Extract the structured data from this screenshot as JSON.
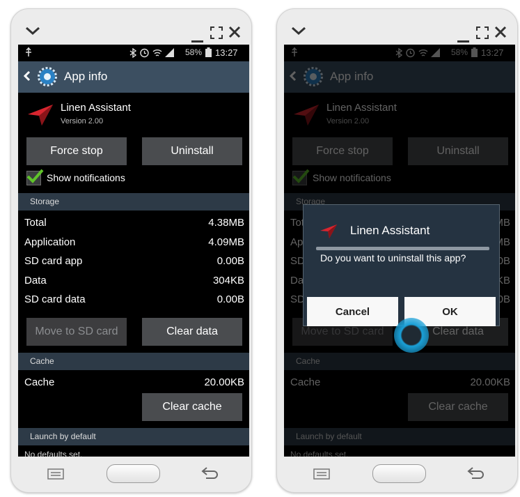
{
  "status_bar": {
    "battery": "58%",
    "time": "13:27"
  },
  "action_bar": {
    "title": "App info"
  },
  "app": {
    "name": "Linen Assistant",
    "version": "Version 2.00"
  },
  "buttons": {
    "force_stop": "Force stop",
    "uninstall": "Uninstall",
    "move_to_sd": "Move to SD card",
    "clear_data": "Clear data",
    "clear_cache": "Clear cache"
  },
  "notifications": {
    "label": "Show notifications",
    "checked": true
  },
  "storage": {
    "header": "Storage",
    "rows": [
      {
        "label": "Total",
        "value": "4.38MB"
      },
      {
        "label": "Application",
        "value": "4.09MB"
      },
      {
        "label": "SD card app",
        "value": "0.00B"
      },
      {
        "label": "Data",
        "value": "304KB"
      },
      {
        "label": "SD card data",
        "value": "0.00B"
      }
    ]
  },
  "cache": {
    "header": "Cache",
    "label": "Cache",
    "value": "20.00KB"
  },
  "launch": {
    "header": "Launch by default",
    "text": "No defaults set."
  },
  "dialog": {
    "title": "Linen Assistant",
    "message": "Do you want to uninstall this app?",
    "cancel": "Cancel",
    "ok": "OK"
  },
  "colors": {
    "action_bar": "#3c4f61",
    "section_header": "#2d3a47",
    "button": "#4a4c4f",
    "dialog": "#253341",
    "check": "#5fc32a",
    "touch": "#1aa0d8",
    "app_icon": "#d8252f"
  },
  "icons": [
    "chevron-down-icon",
    "minimize-icon",
    "maximize-icon",
    "close-icon",
    "usb-icon",
    "bluetooth-icon",
    "alarm-icon",
    "wifi-icon",
    "signal-icon",
    "battery-icon",
    "back-arrow-icon",
    "settings-gear-icon",
    "app-icon",
    "checkmark-icon",
    "menu-icon",
    "home-icon",
    "back-icon"
  ]
}
